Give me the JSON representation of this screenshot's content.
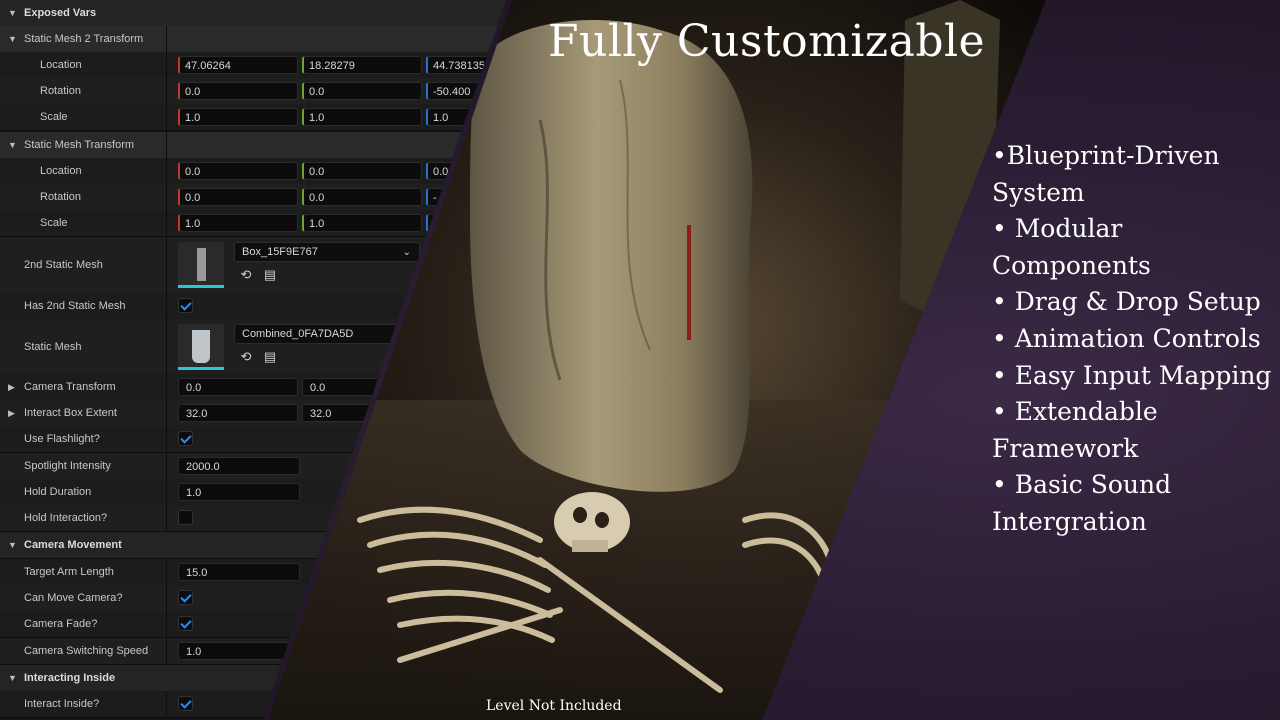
{
  "title": "Fully Customizable",
  "footer": "Level Not Included",
  "features": [
    "•Blueprint-Driven System",
    "• Modular Components",
    "• Drag & Drop Setup",
    "• Animation Controls",
    "• Easy Input Mapping",
    "• Extendable Framework",
    "• Basic Sound Intergration"
  ],
  "panel": {
    "exposed_vars": "Exposed Vars",
    "sm2_transform": {
      "label": "Static Mesh 2 Transform",
      "location": {
        "label": "Location",
        "x": "47.06264",
        "y": "18.28279",
        "z": "44.738135"
      },
      "rotation": {
        "label": "Rotation",
        "x": "0.0",
        "y": "0.0",
        "z": "-50.400"
      },
      "scale": {
        "label": "Scale",
        "x": "1.0",
        "y": "1.0",
        "z": "1.0"
      }
    },
    "sm_transform": {
      "label": "Static Mesh Transform",
      "location": {
        "label": "Location",
        "x": "0.0",
        "y": "0.0",
        "z": "0.0"
      },
      "rotation": {
        "label": "Rotation",
        "x": "0.0",
        "y": "0.0",
        "z": "-"
      },
      "scale": {
        "label": "Scale",
        "x": "1.0",
        "y": "1.0",
        "z": ""
      }
    },
    "second_static_mesh": {
      "label": "2nd Static Mesh",
      "value": "Box_15F9E767"
    },
    "has_2nd_static_mesh": {
      "label": "Has 2nd Static Mesh",
      "checked": true
    },
    "static_mesh": {
      "label": "Static Mesh",
      "value": "Combined_0FA7DA5D"
    },
    "camera_transform": {
      "label": "Camera Transform",
      "x": "0.0",
      "y": "0.0"
    },
    "interact_box_extent": {
      "label": "Interact Box Extent",
      "x": "32.0",
      "y": "32.0"
    },
    "use_flashlight": {
      "label": "Use Flashlight?",
      "checked": true
    },
    "spotlight_intensity": {
      "label": "Spotlight Intensity",
      "value": "2000.0"
    },
    "hold_duration": {
      "label": "Hold Duration",
      "value": "1.0"
    },
    "hold_interaction": {
      "label": "Hold Interaction?",
      "checked": false
    },
    "camera_movement": "Camera Movement",
    "target_arm_length": {
      "label": "Target Arm Length",
      "value": "15.0"
    },
    "can_move_camera": {
      "label": "Can Move Camera?",
      "checked": true
    },
    "camera_fade": {
      "label": "Camera Fade?",
      "checked": true
    },
    "camera_switching_speed": {
      "label": "Camera Switching Speed",
      "value": "1.0"
    },
    "interacting_inside": "Interacting Inside",
    "interact_inside": {
      "label": "Interact Inside?",
      "checked": true
    }
  },
  "colors": {
    "x_axis": "#c1392b",
    "y_axis": "#6aa52c",
    "z_axis": "#2b6fd1",
    "check": "#2d8cf0",
    "mesh_underline": "#2ec4d6"
  }
}
